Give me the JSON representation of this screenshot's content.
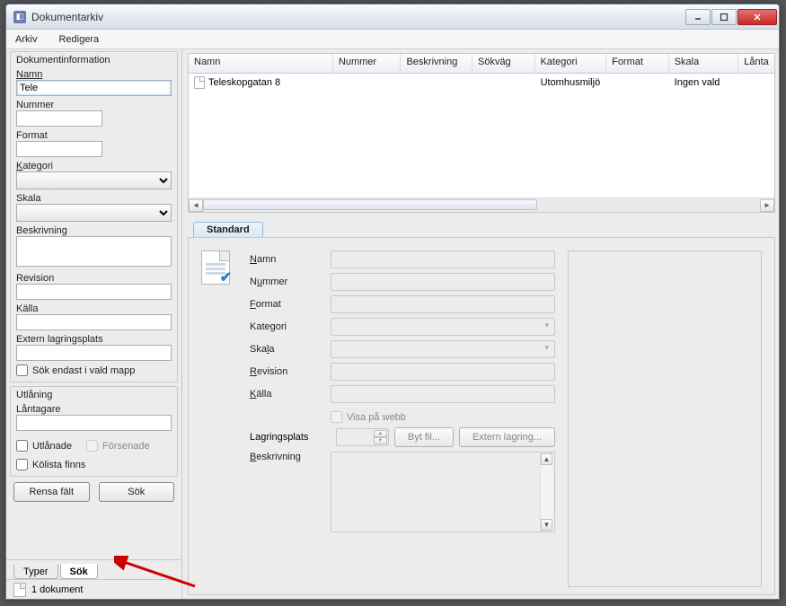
{
  "window": {
    "title": "Dokumentarkiv"
  },
  "menu": {
    "arkiv": "Arkiv",
    "redigera": "Redigera"
  },
  "left": {
    "group_info": "Dokumentinformation",
    "namn_label": "Namn",
    "namn_value": "Tele",
    "nummer_label": "Nummer",
    "format_label": "Format",
    "kategori_label": "Kategori",
    "skala_label": "Skala",
    "beskrivning_label": "Beskrivning",
    "revision_label": "Revision",
    "kalla_label": "Källa",
    "extern_label": "Extern lagringsplats",
    "sok_mapp": "Sök endast i vald mapp",
    "utlaning": "Utlåning",
    "lantagare": "Låntagare",
    "utlanade": "Utlånade",
    "forsenade": "Försenade",
    "kolista": "Kölista finns",
    "rensa": "Rensa fält",
    "sok": "Sök",
    "tab_typer": "Typer",
    "tab_sok": "Sök"
  },
  "status": {
    "text": "1 dokument"
  },
  "grid": {
    "headers": [
      "Namn",
      "Nummer",
      "Beskrivning",
      "Sökväg",
      "Kategori",
      "Format",
      "Skala",
      "Lånta"
    ],
    "rows": [
      {
        "namn": "Teleskopgatan 8",
        "nummer": "",
        "beskrivning": "",
        "sokvag": "",
        "kategori": "Utomhusmiljö",
        "format": "",
        "skala": "Ingen vald",
        "lant": ""
      }
    ]
  },
  "detail": {
    "tab": "Standard",
    "namn": "Namn",
    "nummer": "Nummer",
    "format": "Format",
    "kategori": "Kategori",
    "skala": "Skala",
    "revision": "Revision",
    "kalla": "Källa",
    "visa": "Visa på webb",
    "lagring": "Lagringsplats",
    "bytfil": "Byt fil...",
    "extern": "Extern lagring...",
    "beskrivning": "Beskrivning"
  }
}
